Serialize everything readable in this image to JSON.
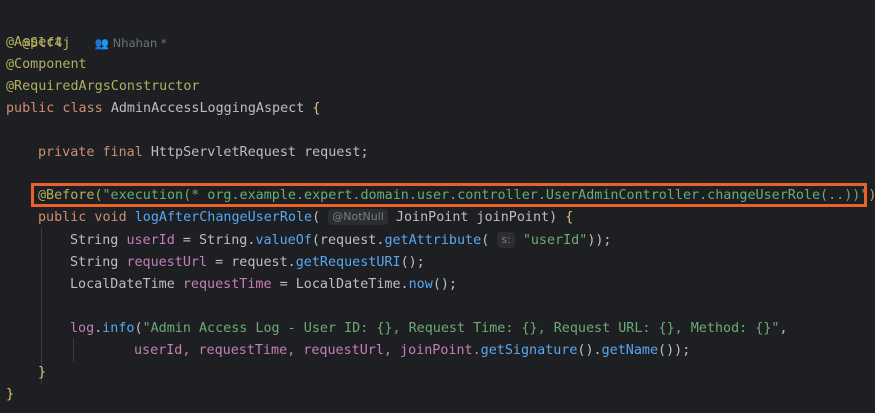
{
  "author": {
    "icon": "people-icon",
    "text": "Nhahan *"
  },
  "lines": {
    "l1_ann": "@Slf4j",
    "l2_ann": "@Aspect",
    "l3_ann": "@Component",
    "l4_ann": "@RequiredArgsConstructor",
    "l5_kw": "public class",
    "l5_name": "AdminAccessLoggingAspect",
    "l5_brace": "{",
    "l7_kw": "private final",
    "l7_type": "HttpServletRequest",
    "l7_rest": "request;",
    "l9_ann": "@Before(",
    "l9_str": "\"execution(* org.example.expert.domain.user.controller.UserAdminController.changeUserRole(..))\"",
    "l9_close": ")",
    "l10_kw": "public void",
    "l10_fn": "logAfterChangeUserRole",
    "l10_open": "(",
    "l10_hint": "@NotNull",
    "l10_rest": "JoinPoint joinPoint)",
    "l10_brace": "{",
    "l11_a": "String",
    "l11_b": "userId",
    "l11_c": "= String.",
    "l11_fn": "valueOf",
    "l11_d": "(request.",
    "l11_fn2": "getAttribute",
    "l11_e": "(",
    "l11_hint": "s:",
    "l11_str": "\"userId\"",
    "l11_f": "));",
    "l12_a": "String",
    "l12_b": "requestUrl",
    "l12_c": "= request.",
    "l12_fn": "getRequestURI",
    "l12_d": "();",
    "l13_a": "LocalDateTime",
    "l13_b": "requestTime",
    "l13_c": "= LocalDateTime.",
    "l13_fn": "now",
    "l13_d": "();",
    "l15_field": "log",
    "l15_a": ".",
    "l15_fn": "info",
    "l15_b": "(",
    "l15_str": "\"Admin Access Log - User ID: {}, Request Time: {}, Request URL: {}, Method: {}\"",
    "l15_c": ",",
    "l16_a": "userId, requestTime, requestUrl, joinPoint.",
    "l16_fn": "getSignature",
    "l16_b": "().",
    "l16_fn2": "getName",
    "l16_c": "());",
    "l17": "}",
    "l18": "}"
  },
  "colors": {
    "highlight_border": "#e8622c",
    "background": "#1e1f22"
  }
}
